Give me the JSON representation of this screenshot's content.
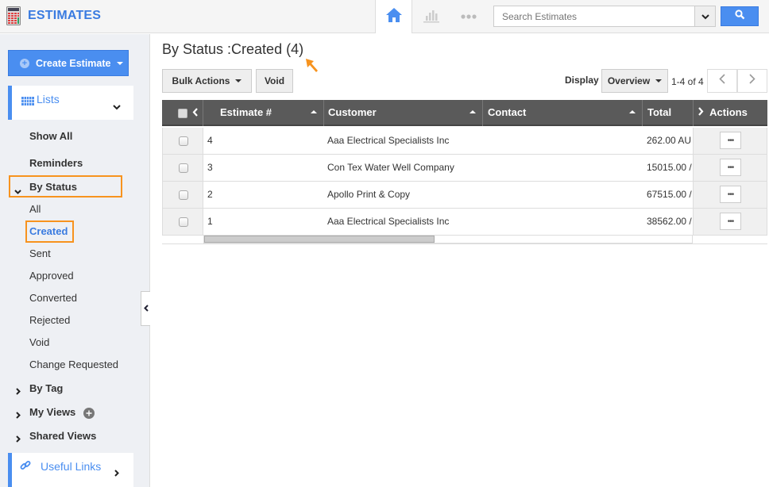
{
  "app": {
    "title": "ESTIMATES"
  },
  "topbar": {
    "icons": [
      "home-icon",
      "chart-icon",
      "more-icon"
    ],
    "search": {
      "placeholder": "Search Estimates",
      "value": ""
    }
  },
  "sidebar": {
    "create_button": "Create Estimate",
    "lists_panel": "Lists",
    "items": {
      "show_all": "Show All",
      "reminders": "Reminders",
      "by_status": "By Status",
      "status_items": [
        "All",
        "Created",
        "Sent",
        "Approved",
        "Converted",
        "Rejected",
        "Void",
        "Change Requested"
      ],
      "by_tag": "By Tag",
      "my_views": "My Views",
      "shared_views": "Shared Views"
    },
    "useful_links": "Useful Links",
    "active_status": "Created"
  },
  "main": {
    "title": "By Status :Created (4)",
    "bulk_actions": "Bulk Actions",
    "void": "Void",
    "display_label": "Display",
    "display_value": "Overview",
    "page_count": "1-4 of 4"
  },
  "table": {
    "columns": [
      "Estimate #",
      "Customer",
      "Contact",
      "Total",
      "Actions"
    ],
    "rows": [
      {
        "estimate": "4",
        "customer": "Aaa Electrical Specialists Inc",
        "contact": "",
        "total": "262.00 AU"
      },
      {
        "estimate": "3",
        "customer": "Con Tex Water Well Company",
        "contact": "",
        "total": "15015.00 /"
      },
      {
        "estimate": "2",
        "customer": "Apollo Print & Copy",
        "contact": "",
        "total": "67515.00 /"
      },
      {
        "estimate": "1",
        "customer": "Aaa Electrical Specialists Inc",
        "contact": "",
        "total": "38562.00 /"
      }
    ],
    "row_action": "•••"
  },
  "colors": {
    "accent": "#4a8ef0",
    "highlight": "#f7931e",
    "header_bg": "#5a5a5a"
  }
}
